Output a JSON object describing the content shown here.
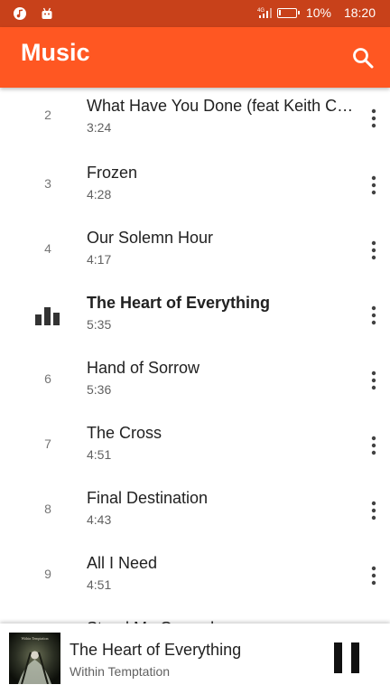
{
  "status_bar": {
    "left_icons": [
      "music-app-notification-icon",
      "android-notification-icon"
    ],
    "battery_percent_label": "10%",
    "battery_level": 0.1,
    "time": "18:20"
  },
  "app_bar": {
    "title": "Music",
    "search_icon": "search-icon",
    "color": "#ff5722"
  },
  "tracks": [
    {
      "number": "2",
      "title": "What Have You Done (feat Keith C…",
      "duration": "3:24",
      "playing": false
    },
    {
      "number": "3",
      "title": "Frozen",
      "duration": "4:28",
      "playing": false
    },
    {
      "number": "4",
      "title": "Our Solemn Hour",
      "duration": "4:17",
      "playing": false
    },
    {
      "number": "",
      "title": "The Heart of Everything",
      "duration": "5:35",
      "playing": true
    },
    {
      "number": "6",
      "title": "Hand of Sorrow",
      "duration": "5:36",
      "playing": false
    },
    {
      "number": "7",
      "title": "The Cross",
      "duration": "4:51",
      "playing": false
    },
    {
      "number": "8",
      "title": "Final Destination",
      "duration": "4:43",
      "playing": false
    },
    {
      "number": "9",
      "title": "All I Need",
      "duration": "4:51",
      "playing": false
    },
    {
      "number": "",
      "title": "Stand My Ground",
      "duration": "",
      "playing": false
    }
  ],
  "now_playing": {
    "title": "The Heart of Everything",
    "artist": "Within Temptation",
    "art_caption": "Within Temptation",
    "control_icon": "pause-icon"
  }
}
